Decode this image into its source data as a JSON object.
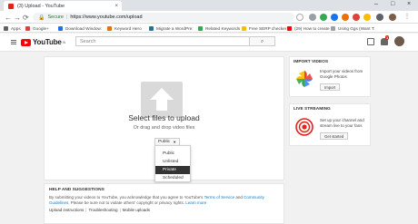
{
  "browser": {
    "tab_title": "(3) Upload - YouTube",
    "tab_close": "×",
    "window_controls": [
      "–",
      "□",
      "×"
    ],
    "nav_icons": [
      "←",
      "→",
      "⟳"
    ],
    "secure_label": "Secure",
    "url": "https://www.youtube.com/upload",
    "bookmarks": [
      {
        "label": "Apps",
        "color": "#5f6368"
      },
      {
        "label": "Google+",
        "color": "#db4437"
      },
      {
        "label": "Download Window:",
        "color": "#1a73e8"
      },
      {
        "label": "Keyword Hero",
        "color": "#e8710a"
      },
      {
        "label": "Migrate a WordPre:",
        "color": "#21759b"
      },
      {
        "label": "Related Keywords",
        "color": "#34a853"
      },
      {
        "label": "Free SERP checker",
        "color": "#fbbc04"
      },
      {
        "label": "(29) How to create",
        "color": "#ff0000"
      },
      {
        "label": "Using Ggs (Want T:",
        "color": "#9aa0a6"
      }
    ]
  },
  "youtube": {
    "logo_text": "YouTube",
    "logo_sup": "IN",
    "search_placeholder": "Search",
    "search_icon": "⌕",
    "notification_count": "3"
  },
  "upload": {
    "title": "Select files to upload",
    "subtitle": "Or drag and drop video files",
    "privacy_selected": "Public",
    "privacy_options": [
      "Public",
      "Unlisted",
      "Private",
      "Scheduled"
    ],
    "highlighted_option_index": 2
  },
  "help": {
    "heading": "HELP AND SUGGESTIONS",
    "text_before": "By submitting your videos to YouTube, you acknowledge that you agree to YouTube's ",
    "tos": "Terms of Service",
    "and": " and ",
    "guidelines": "Community Guidelines",
    "text_line2": ". Please be sure not to violate others' copyright or privacy rights. ",
    "learn_more": "Learn more",
    "links": [
      "Upload instructions",
      "Troubleshooting",
      "Mobile uploads"
    ]
  },
  "import_card": {
    "title": "IMPORT VIDEOS",
    "description": "Import your videos from Google Photos",
    "button": "Import"
  },
  "live_card": {
    "title": "LIVE STREAMING",
    "description": "Set up your channel and stream live to your fans",
    "button": "Get started"
  }
}
